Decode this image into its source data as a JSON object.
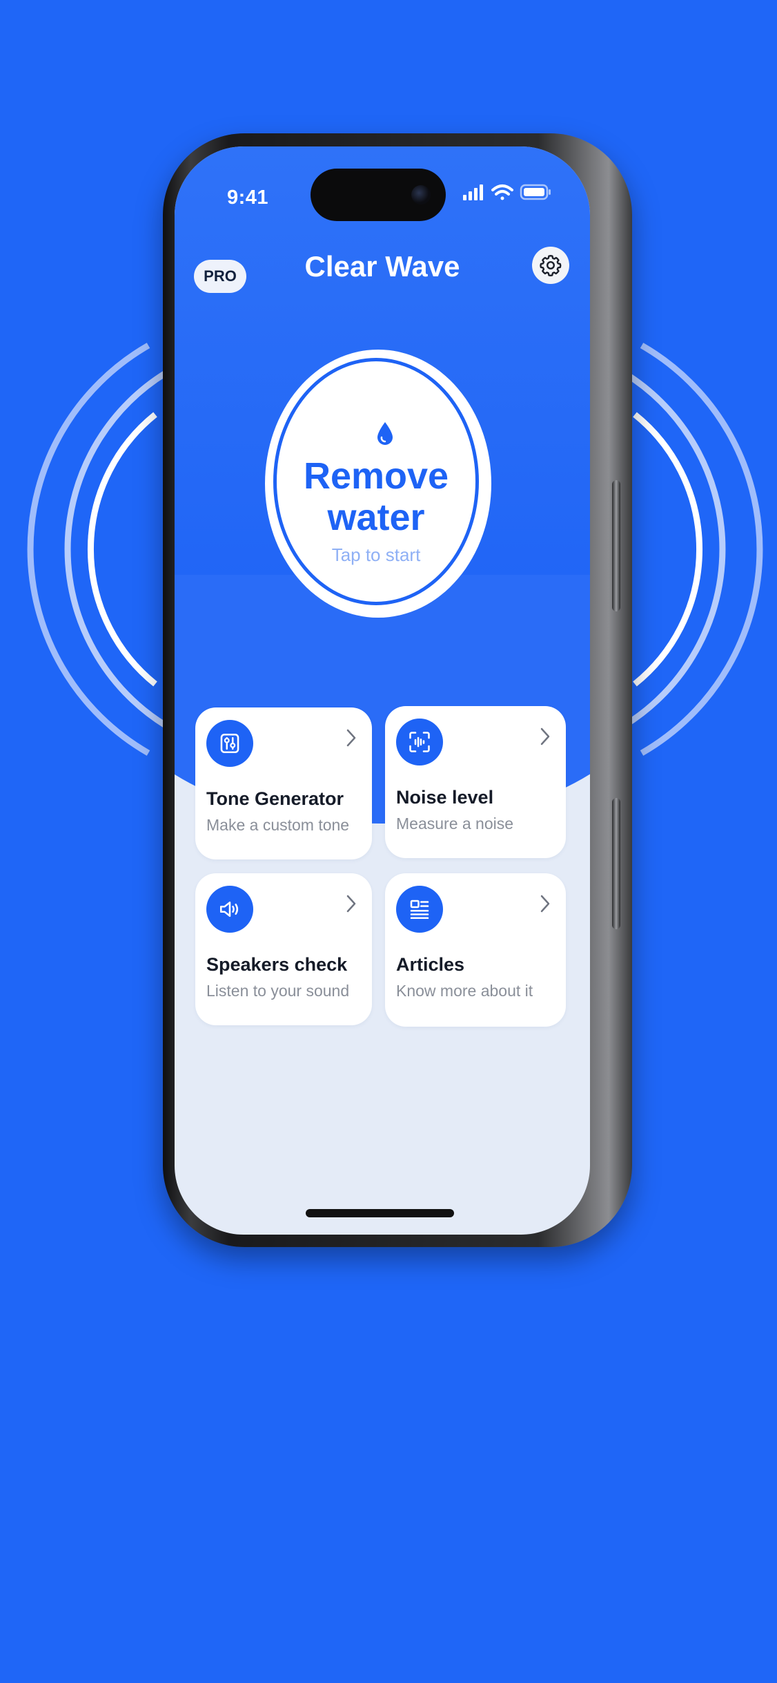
{
  "colors": {
    "background": "#1f66f7",
    "accent": "#1e63f5",
    "screen_bg": "#e4ebf7",
    "card_bg": "#ffffff"
  },
  "status_bar": {
    "time": "9:41",
    "icons": [
      "signal-icon",
      "wifi-icon",
      "battery-icon"
    ]
  },
  "header": {
    "pro_label": "PRO",
    "title": "Clear Wave",
    "settings_icon": "gear-icon"
  },
  "main_action": {
    "icon": "water-drop-icon",
    "title_line1": "Remove",
    "title_line2": "water",
    "subtitle": "Tap to start"
  },
  "cards": [
    {
      "icon": "sliders-icon",
      "title": "Tone Generator",
      "subtitle": "Make a custom tone"
    },
    {
      "icon": "soundwave-scan-icon",
      "title": "Noise level",
      "subtitle": "Measure a noise"
    },
    {
      "icon": "speaker-icon",
      "title": "Speakers check",
      "subtitle": "Listen to your sound"
    },
    {
      "icon": "article-icon",
      "title": "Articles",
      "subtitle": "Know more about it"
    }
  ]
}
